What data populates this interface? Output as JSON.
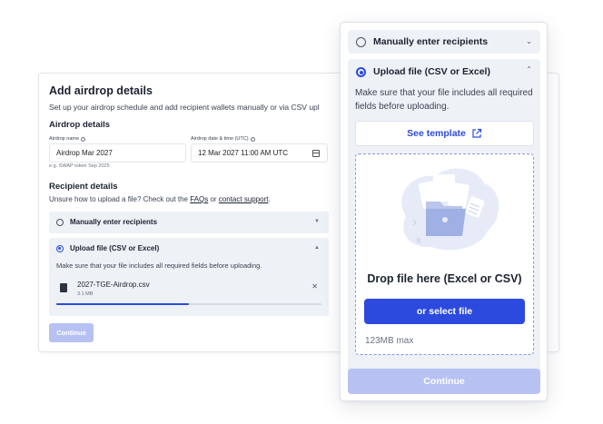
{
  "back": {
    "title": "Add airdrop details",
    "subtitle": "Set up your airdrop schedule and add recipient wallets manually or via CSV upl",
    "airdrop_details_title": "Airdrop details",
    "airdrop_name_label": "Airdrop name",
    "airdrop_name_value": "Airdrop Mar 2027",
    "airdrop_name_hint": "e.g. SWAP token Sep 2025",
    "date_label": "Airdrop date & time (UTC)",
    "date_value": "12 Mar 2027 11:00 AM UTC",
    "recipient_title": "Recipient details",
    "unsure_text": "Unsure how to upload a file? Check out the ",
    "faqs_link": "FAQs",
    "or_text": " or ",
    "support_link": "contact support",
    "period": ".",
    "option_manual": "Manually enter recipients",
    "option_upload": "Upload file (CSV or Excel)",
    "upload_desc": "Make sure that your file includes all required fields before uploading.",
    "file_name": "2027-TGE-Airdrop.csv",
    "file_size": "3.1 MB",
    "upload_progress": 0.5,
    "continue_label": "Continue"
  },
  "front": {
    "option_manual": "Manually enter recipients",
    "option_upload": "Upload file (CSV or Excel)",
    "upload_desc": "Make sure that your file includes all required fields before uploading.",
    "template_label": "See template",
    "drop_title": "Drop file here (Excel or CSV)",
    "select_label": "or select file",
    "max_size": "123MB max",
    "continue_label": "Continue"
  },
  "colors": {
    "accent": "#2c4bde",
    "accent_disabled": "#b7c2f3",
    "option_bg": "#eef1f6"
  },
  "icons": [
    "info-icon",
    "calendar-icon",
    "chevron-down-icon",
    "chevron-up-icon",
    "file-icon",
    "close-icon",
    "external-link-icon",
    "folder-upload-illustration"
  ]
}
